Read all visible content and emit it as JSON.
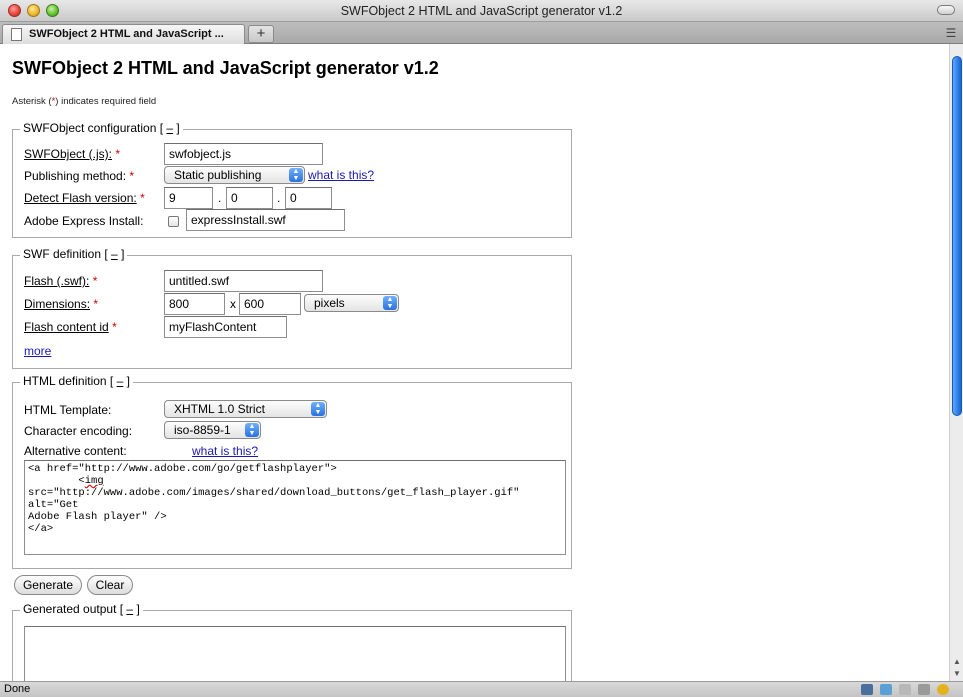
{
  "window": {
    "title": "SWFObject 2 HTML and JavaScript generator v1.2"
  },
  "tabs": [
    {
      "label": "SWFObject 2 HTML and JavaScript ..."
    }
  ],
  "newtab": {
    "label": "+"
  },
  "page": {
    "title": "SWFObject 2 HTML and JavaScript generator v1.2",
    "note": {
      "before": "Asterisk (",
      "star": "*",
      "after": ") indicates required field"
    }
  },
  "toggle": {
    "before": " [ ",
    "link": "–",
    "after": " ]"
  },
  "required_marker": "*",
  "config": {
    "legend": "SWFObject configuration",
    "swfobject_label": "SWFObject (.js):",
    "swfobject_value": "swfobject.js",
    "publishing_label": "Publishing method:",
    "publishing_value": "Static publishing",
    "publishing_help": "what is this?",
    "detect_label": "Detect Flash version:",
    "version_major": "9",
    "version_minor": "0",
    "version_release": "0",
    "version_sep": ".",
    "express_label": "Adobe Express Install:",
    "express_value": "expressInstall.swf",
    "express_checked": false
  },
  "swf": {
    "legend": "SWF definition",
    "flash_label": "Flash (.swf):",
    "flash_value": "untitled.swf",
    "dimensions_label": "Dimensions:",
    "width": "800",
    "times": "x",
    "height": "600",
    "unit": "pixels",
    "id_label": "Flash content id",
    "id_value": "myFlashContent",
    "more": "more"
  },
  "html": {
    "legend": "HTML definition",
    "template_label": "HTML Template:",
    "template_value": "XHTML 1.0 Strict",
    "encoding_label": "Character encoding:",
    "encoding_value": "iso-8859-1",
    "alt_label": "Alternative content:",
    "alt_help": "what is this?",
    "alt_line1": "<a href=\"http://www.adobe.com/go/getflashplayer\">",
    "alt_line2_indent": "        <",
    "alt_line2_tag": "img",
    "alt_line2_rest": " src=\"http://www.adobe.com/images/shared/download_buttons/get_flash_player.gif\" alt=\"Get",
    "alt_line3": "Adobe Flash player\" />",
    "alt_line4": "</a>"
  },
  "actions": {
    "generate": "Generate",
    "clear": "Clear"
  },
  "output": {
    "legend": "Generated output"
  },
  "status": {
    "text": "Done"
  },
  "icons": [
    "window-close-icon",
    "tab-list-icon",
    "page-icon",
    "select-arrows-icon",
    "status-tool-icons"
  ]
}
